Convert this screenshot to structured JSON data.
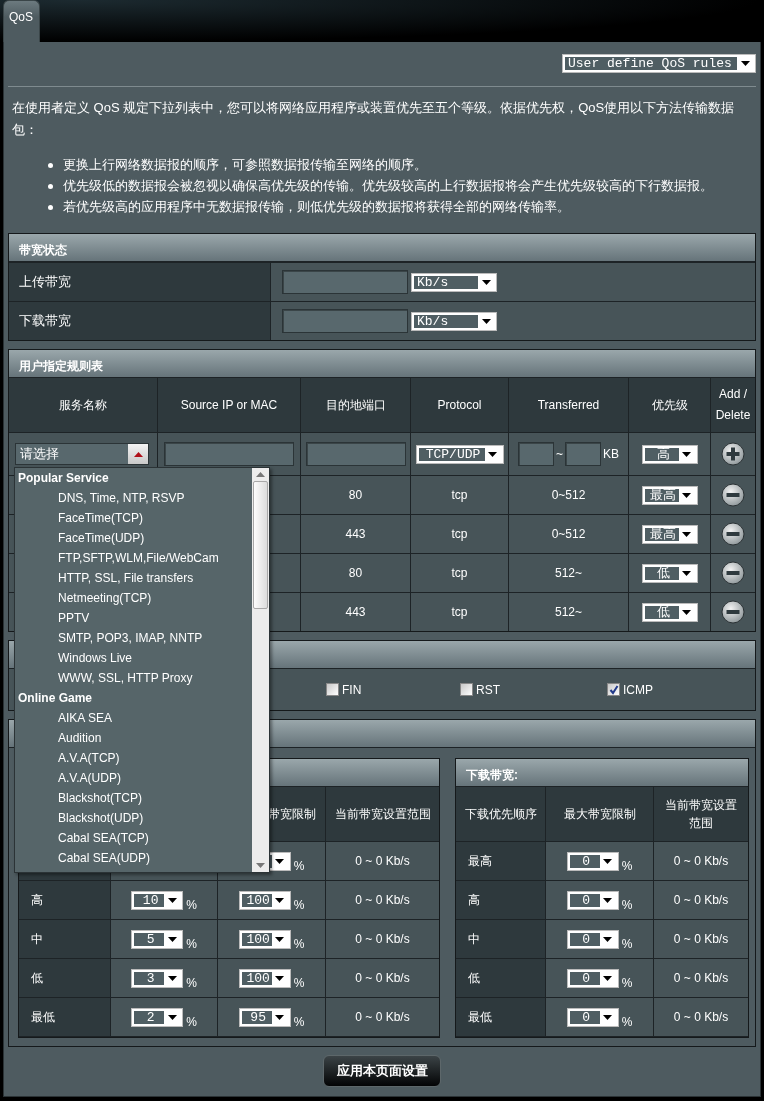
{
  "tabs": [
    {
      "label": "QoS",
      "selected": true
    }
  ],
  "mode_select": {
    "value": "User define QoS rules"
  },
  "intro": {
    "paragraph": "在使用者定义 QoS 规定下拉列表中，您可以将网络应用程序或装置优先至五个等级。依据优先权，QoS使用以下方法传输数据包：",
    "bullets": [
      "更换上行网络数据报的顺序，可参照数据报传输至网络的顺序。",
      "优先级低的数据报会被忽视以确保高优先级的传输。优先级较高的上行数据报将会产生优先级较高的下行数据报。",
      "若优先级高的应用程序中无数据报传输，则低优先级的数据报将获得全部的网络传输率。"
    ]
  },
  "bandwidth_status": {
    "title": "带宽状态",
    "rows": [
      {
        "label": "上传带宽",
        "unit": "Kb/s"
      },
      {
        "label": "下载带宽",
        "unit": "Kb/s"
      }
    ]
  },
  "rules": {
    "title": "用户指定规则表",
    "columns": [
      "服务名称",
      "Source IP or MAC",
      "目的地端口",
      "Protocol",
      "Transferred",
      "优先级",
      "Add / Delete"
    ],
    "new_rule": {
      "service": {
        "value": "请选择",
        "expanded": true
      },
      "protocol": "TCP/UDP",
      "range_separator": "~",
      "unit": "KB",
      "priority": "高"
    },
    "rows": [
      {
        "port": "80",
        "protocol": "tcp",
        "transferred": "0~512",
        "priority": "最高"
      },
      {
        "port": "443",
        "protocol": "tcp",
        "transferred": "0~512",
        "priority": "最高"
      },
      {
        "port": "80",
        "protocol": "tcp",
        "transferred": "512~",
        "priority": "低"
      },
      {
        "port": "443",
        "protocol": "tcp",
        "transferred": "512~",
        "priority": "低"
      }
    ]
  },
  "service_menu": [
    {
      "title": "Popular Service",
      "items": [
        "DNS, Time, NTP, RSVP",
        "FaceTime(TCP)",
        "FaceTime(UDP)",
        "FTP,SFTP,WLM,File/WebCam",
        "HTTP, SSL, File transfers",
        "Netmeeting(TCP)",
        "PPTV",
        "SMTP, POP3, IMAP, NNTP",
        "Windows Live",
        "WWW, SSL, HTTP Proxy"
      ]
    },
    {
      "title": "Online Game",
      "items": [
        "AIKA SEA",
        "Audition",
        "A.V.A(TCP)",
        "A.V.A(UDP)",
        "Blackshot(TCP)",
        "Blackshot(UDP)",
        "Cabal SEA(TCP)",
        "Cabal SEA(UDP)"
      ]
    }
  ],
  "tcp_flags": {
    "items": [
      {
        "label": "FIN",
        "checked": false
      },
      {
        "label": "RST",
        "checked": false
      },
      {
        "label": "ICMP",
        "checked": true
      }
    ]
  },
  "upload_limits": {
    "max_header": "带宽限制",
    "range_header": "当前带宽设置范围",
    "rows": [
      {
        "max_unit": "%",
        "range": "0 ~ 0 Kb/s"
      },
      {
        "priority": "高",
        "min": "10",
        "min_unit": "%",
        "max": "100",
        "max_unit": "%",
        "range": "0 ~ 0 Kb/s"
      },
      {
        "priority": "中",
        "min": "5",
        "min_unit": "%",
        "max": "100",
        "max_unit": "%",
        "range": "0 ~ 0 Kb/s"
      },
      {
        "priority": "低",
        "min": "3",
        "min_unit": "%",
        "max": "100",
        "max_unit": "%",
        "range": "0 ~ 0 Kb/s"
      },
      {
        "priority": "最低",
        "min": "2",
        "min_unit": "%",
        "max": "95",
        "max_unit": "%",
        "range": "0 ~ 0 Kb/s"
      }
    ]
  },
  "download_limits": {
    "title": "下载带宽:",
    "columns": [
      "下载优先顺序",
      "最大带宽限制",
      "当前带宽设置范围"
    ],
    "rows": [
      {
        "priority": "最高",
        "max": "0",
        "max_unit": "%",
        "range": "0 ~ 0 Kb/s"
      },
      {
        "priority": "高",
        "max": "0",
        "max_unit": "%",
        "range": "0 ~ 0 Kb/s"
      },
      {
        "priority": "中",
        "max": "0",
        "max_unit": "%",
        "range": "0 ~ 0 Kb/s"
      },
      {
        "priority": "低",
        "max": "0",
        "max_unit": "%",
        "range": "0 ~ 0 Kb/s"
      },
      {
        "priority": "最低",
        "max": "0",
        "max_unit": "%",
        "range": "0 ~ 0 Kb/s"
      }
    ]
  },
  "apply_button": "应用本页面设置"
}
